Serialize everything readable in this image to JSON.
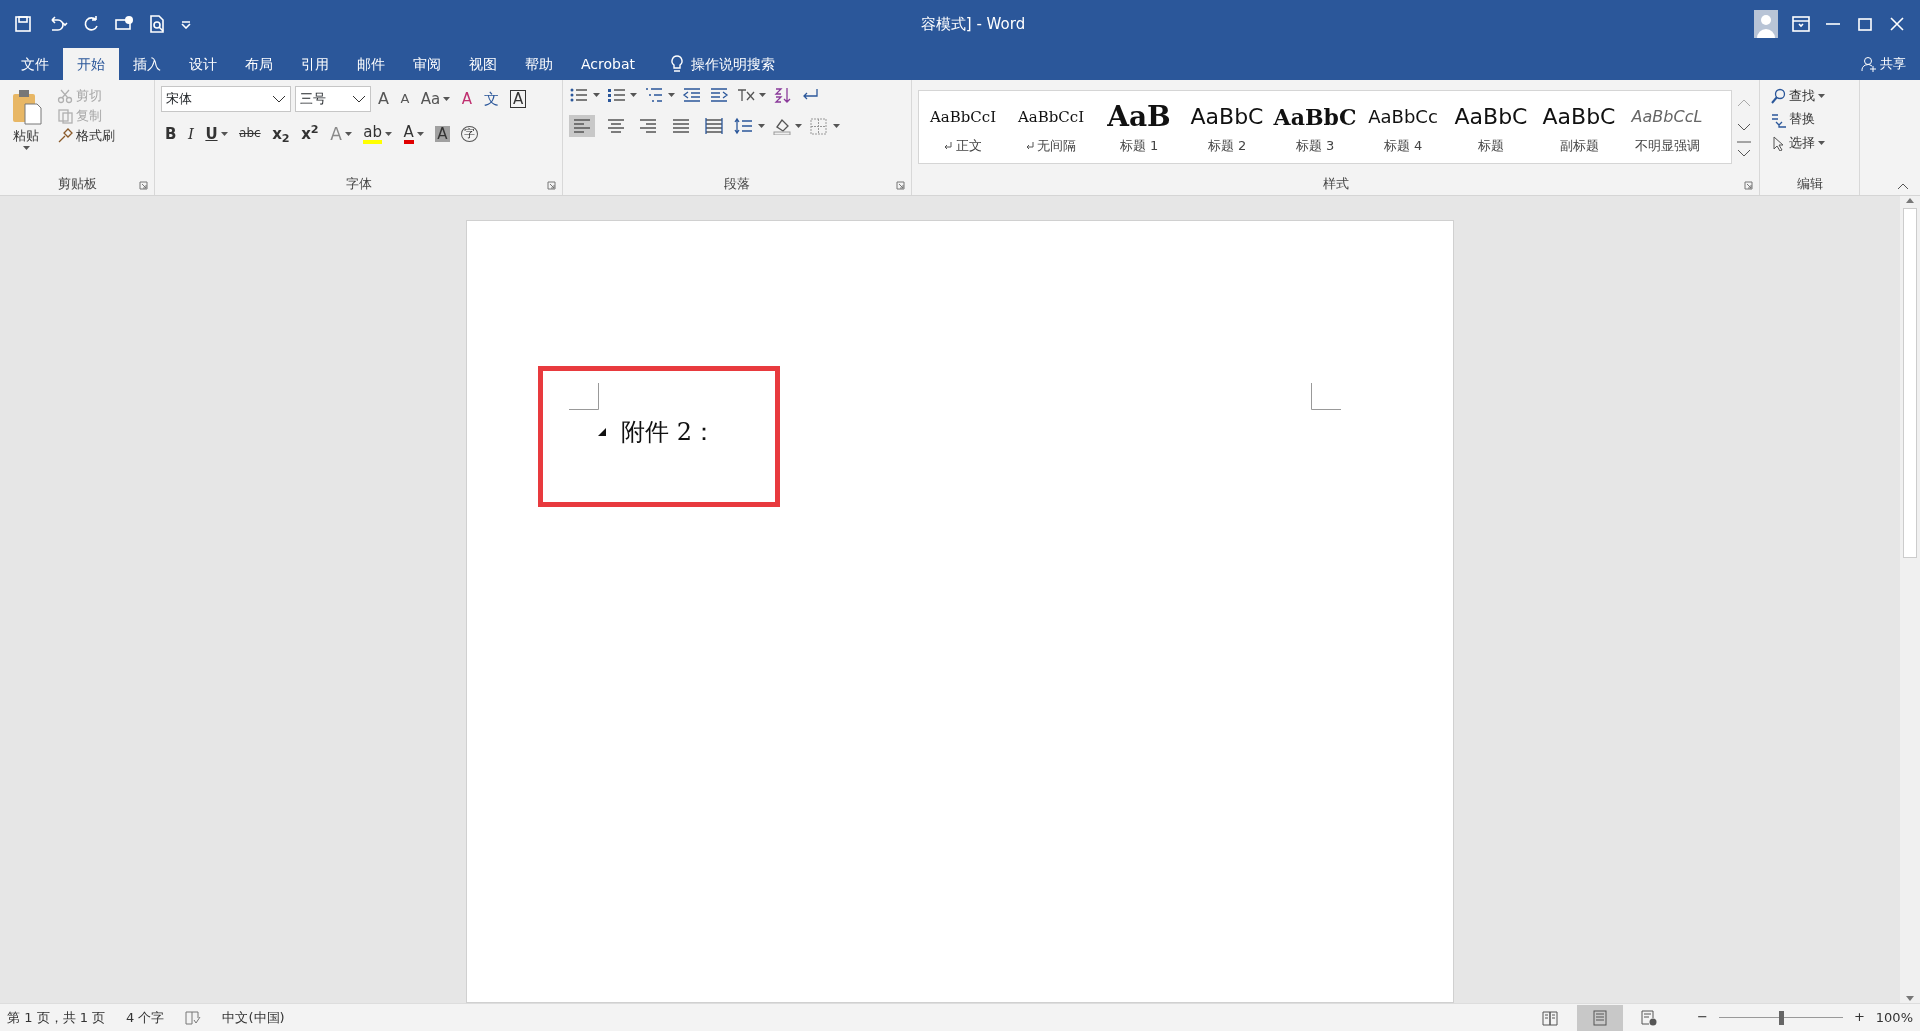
{
  "window": {
    "title": "容模式] - Word"
  },
  "tabs": [
    {
      "label": "文件",
      "selected": false
    },
    {
      "label": "开始",
      "selected": true
    },
    {
      "label": "插入",
      "selected": false
    },
    {
      "label": "设计",
      "selected": false
    },
    {
      "label": "布局",
      "selected": false
    },
    {
      "label": "引用",
      "selected": false
    },
    {
      "label": "邮件",
      "selected": false
    },
    {
      "label": "审阅",
      "selected": false
    },
    {
      "label": "视图",
      "selected": false
    },
    {
      "label": "帮助",
      "selected": false
    },
    {
      "label": "Acrobat",
      "selected": false
    }
  ],
  "tell_me": {
    "label": "操作说明搜索"
  },
  "share": {
    "label": "共享"
  },
  "clipboard": {
    "title": "剪贴板",
    "paste": "粘贴",
    "items": [
      {
        "label": "剪切",
        "kind": "cut",
        "disabled": true
      },
      {
        "label": "复制",
        "kind": "copy",
        "disabled": true
      },
      {
        "label": "格式刷",
        "kind": "brush",
        "disabled": false
      }
    ]
  },
  "font": {
    "title": "字体",
    "font_name": "宋体",
    "font_size": "三号",
    "row1": [
      {
        "kind": "grow",
        "text": "A"
      },
      {
        "kind": "shrink",
        "text": "A"
      },
      {
        "kind": "case",
        "text": "Aa"
      },
      {
        "kind": "clear",
        "text": "A"
      },
      {
        "kind": "pinyin",
        "text": "文"
      },
      {
        "kind": "border",
        "text": "A"
      }
    ],
    "row2": [
      {
        "kind": "plain",
        "text": "B"
      },
      {
        "kind": "italic",
        "text": "I"
      },
      {
        "kind": "underline",
        "text": "U"
      },
      {
        "kind": "strike",
        "text": "abc"
      },
      {
        "kind": "plain",
        "text": "x$_{2}$"
      },
      {
        "kind": "plain",
        "text": "x$^{2}$"
      },
      {
        "kind": "effect",
        "text": "A"
      },
      {
        "kind": "highlight",
        "text": "ab",
        "color": "#ffff00"
      },
      {
        "kind": "fontcolor",
        "text": "A",
        "color": "#e00000"
      },
      {
        "kind": "shade",
        "text": "A"
      },
      {
        "kind": "enclose",
        "text": "字"
      }
    ]
  },
  "paragraph": {
    "title": "段落",
    "align": [
      {
        "kind": "left",
        "selected": true
      },
      {
        "kind": "center",
        "selected": false
      },
      {
        "kind": "right",
        "selected": false
      },
      {
        "kind": "justify",
        "selected": false
      },
      {
        "kind": "distributed",
        "selected": false
      }
    ]
  },
  "styles": {
    "title": "样式",
    "items": [
      {
        "preview": "AaBbCcI",
        "label": "正文",
        "kind": "serif",
        "para_mark": true
      },
      {
        "preview": "AaBbCcI",
        "label": "无间隔",
        "kind": "serif",
        "para_mark": true
      },
      {
        "preview": "AaB",
        "label": "标题 1",
        "kind": "title",
        "para_mark": false
      },
      {
        "preview": "AaBbC",
        "label": "标题 2",
        "kind": "sans",
        "para_mark": false
      },
      {
        "preview": "AaBbC",
        "label": "标题 3",
        "kind": "bold",
        "para_mark": false
      },
      {
        "preview": "AaBbCc",
        "label": "标题 4",
        "kind": "sans-small",
        "para_mark": false
      },
      {
        "preview": "AaBbC",
        "label": "标题",
        "kind": "sans",
        "para_mark": false
      },
      {
        "preview": "AaBbC",
        "label": "副标题",
        "kind": "sans",
        "para_mark": false
      },
      {
        "preview": "AaBbCcL",
        "label": "不明显强调",
        "kind": "italic",
        "para_mark": false
      }
    ]
  },
  "editing": {
    "title": "编辑",
    "items": [
      {
        "label": "查找",
        "kind": "find",
        "dropdown": true
      },
      {
        "label": "替换",
        "kind": "replace",
        "dropdown": false
      },
      {
        "label": "选择",
        "kind": "select",
        "dropdown": true
      }
    ]
  },
  "document": {
    "text": "附件 2："
  },
  "status_bar": {
    "page": "第 1 页，共 1 页",
    "words": "4 个字",
    "language": "中文(中国)",
    "views": [
      {
        "kind": "read",
        "selected": false
      },
      {
        "kind": "print",
        "selected": true
      },
      {
        "kind": "web",
        "selected": false
      }
    ],
    "zoom_out": "−",
    "zoom_in": "+",
    "zoom": {
      "level": 0.5
    },
    "zoom_text": "100%"
  }
}
